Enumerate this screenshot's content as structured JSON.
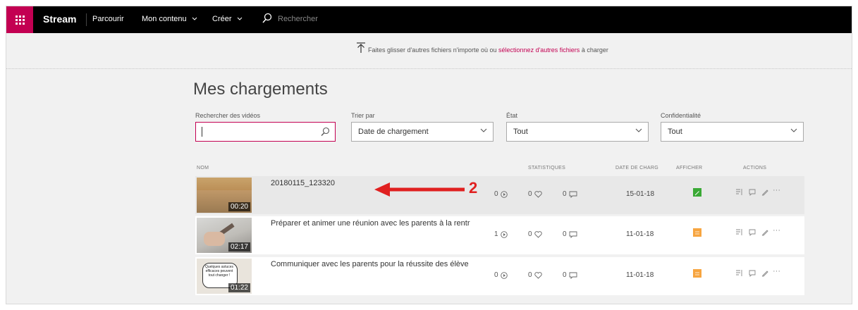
{
  "app": {
    "brand": "Stream"
  },
  "nav": {
    "browse": "Parcourir",
    "my_content": "Mon contenu",
    "create": "Créer",
    "search_placeholder": "Rechercher"
  },
  "upload": {
    "text_before": "Faites glisser d'autres fichiers n'importe où ou ",
    "link": "sélectionnez d'autres fichiers",
    "text_after": " à charger"
  },
  "page": {
    "title": "Mes chargements"
  },
  "filters": {
    "search_label": "Rechercher des vidéos",
    "search_value": "",
    "sort_label": "Trier par",
    "sort_value": "Date de chargement",
    "state_label": "État",
    "state_value": "Tout",
    "privacy_label": "Confidentialité",
    "privacy_value": "Tout"
  },
  "table": {
    "headers": {
      "name": "NOM",
      "stats": "STATISTIQUES",
      "date": "DATE DE CHARG",
      "display": "AFFICHER",
      "actions": "ACTIONS"
    },
    "rows": [
      {
        "name": "20180115_123320",
        "duration": "00:20",
        "views": "0",
        "likes": "0",
        "comments": "0",
        "date": "15-01-18",
        "visibility_color": "#3aa935"
      },
      {
        "name": "Préparer et animer une réunion avec les parents à la rentr",
        "duration": "02:17",
        "views": "1",
        "likes": "0",
        "comments": "0",
        "date": "11-01-18",
        "visibility_color": "#f7a540"
      },
      {
        "name": "Communiquer avec les parents pour la réussite des élève",
        "duration": "01:22",
        "views": "0",
        "likes": "0",
        "comments": "0",
        "date": "11-01-18",
        "visibility_color": "#f7a540",
        "thumb_text": "Quelques astuces efficaces peuvent tout changer !"
      }
    ],
    "more_label": "···"
  },
  "annotation": {
    "number": "2",
    "color": "#e02020"
  }
}
